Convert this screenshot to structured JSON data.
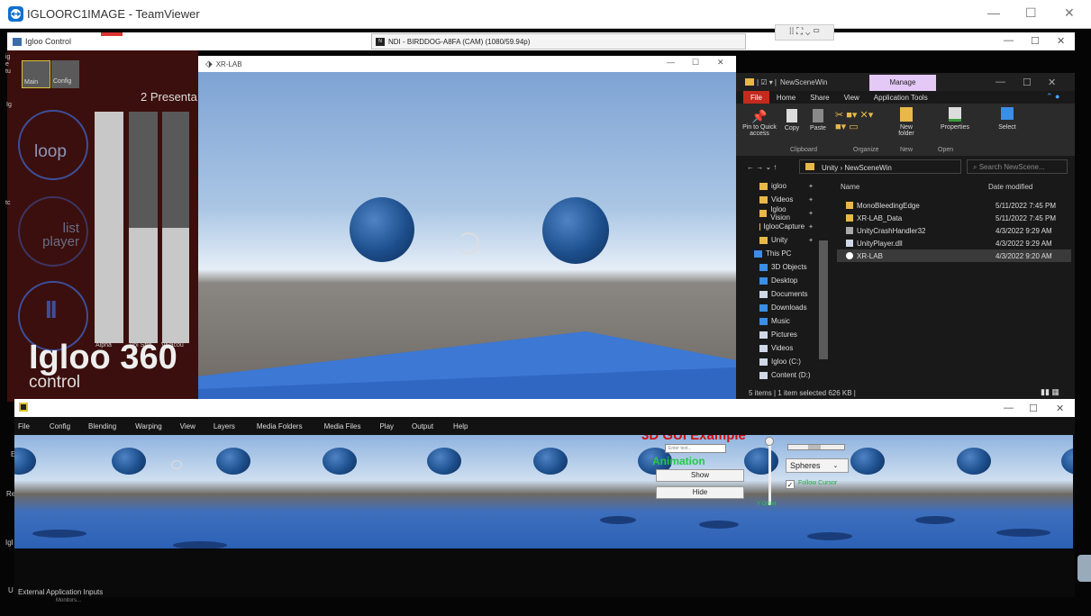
{
  "teamviewer": {
    "title": "IGLOORC1IMAGE - TeamViewer",
    "min": "—",
    "max": "☐",
    "close": "✕"
  },
  "igloo_control": {
    "window_title": "Igloo Control",
    "tabs": [
      "Main",
      "Config"
    ],
    "presentation_label": "2 Presenta",
    "loop_label": "loop",
    "list_player_label": "list player",
    "pause_symbol": "II",
    "slider_labels": [
      "Alpha",
      "Vol Stre",
      "Vivacou"
    ],
    "slider_levels": [
      1.0,
      0.5,
      0.5
    ],
    "logo_main": "Igloo 360",
    "logo_sub": "control",
    "side_text": [
      "ig",
      "e",
      "tu",
      "Ig",
      "tc",
      "E",
      "Re",
      "Igl",
      "U"
    ]
  },
  "ndi": {
    "title": "NDI - BIRDDOG-A8FA (CAM) (1080/59.94p)"
  },
  "xrlab": {
    "title": "XR-LAB",
    "min": "—",
    "max": "☐",
    "close": "✕"
  },
  "explorer": {
    "title": "NewSceneWin",
    "manage_tab": "Manage",
    "ribbon_tabs": [
      "File",
      "Home",
      "Share",
      "View",
      "Application Tools"
    ],
    "ribbon_groups": [
      "Clipboard",
      "Organize",
      "New",
      "Open"
    ],
    "ribbon_buttons": [
      "Pin to Quick access",
      "Copy",
      "Paste",
      "New folder",
      "Properties",
      "Select"
    ],
    "address": [
      "Unity",
      "NewSceneWin"
    ],
    "search_placeholder": "Search NewScene...",
    "col_name": "Name",
    "col_date": "Date modified",
    "nav_items": [
      {
        "label": "igloo",
        "kind": "folder"
      },
      {
        "label": "Videos",
        "kind": "folder"
      },
      {
        "label": "Igloo Vision",
        "kind": "folder"
      },
      {
        "label": "IglooCapture",
        "kind": "folder"
      },
      {
        "label": "Unity",
        "kind": "folder"
      },
      {
        "label": "This PC",
        "kind": "pc"
      },
      {
        "label": "3D Objects",
        "kind": "obj"
      },
      {
        "label": "Desktop",
        "kind": "desk"
      },
      {
        "label": "Documents",
        "kind": "doc"
      },
      {
        "label": "Downloads",
        "kind": "down"
      },
      {
        "label": "Music",
        "kind": "music"
      },
      {
        "label": "Pictures",
        "kind": "pic"
      },
      {
        "label": "Videos",
        "kind": "vid"
      },
      {
        "label": "Igloo (C:)",
        "kind": "drive"
      },
      {
        "label": "Content (D:)",
        "kind": "drive"
      }
    ],
    "files": [
      {
        "name": "MonoBleedingEdge",
        "date": "5/11/2022 7:45 PM",
        "kind": "folder"
      },
      {
        "name": "XR-LAB_Data",
        "date": "5/11/2022 7:45 PM",
        "kind": "folder"
      },
      {
        "name": "UnityCrashHandler32",
        "date": "4/3/2022 9:29 AM",
        "kind": "exe"
      },
      {
        "name": "UnityPlayer.dll",
        "date": "4/3/2022 9:29 AM",
        "kind": "dll"
      },
      {
        "name": "XR-LAB",
        "date": "4/3/2022 9:20 AM",
        "kind": "unity"
      }
    ],
    "status": "5 items  |  1 item selected  626 KB  |"
  },
  "igloo_main": {
    "menu": [
      "File",
      "Config",
      "Blending",
      "Warping",
      "View",
      "Layers",
      "Media Folders",
      "Media Files",
      "Play",
      "Output",
      "Help"
    ],
    "gui_title": "3D GUI Example",
    "gui_input_placeholder": "Enter text...",
    "animation_label": "Animation",
    "show_label": "Show",
    "hide_label": "Hide",
    "slider_label": "Y Offset",
    "dropdown_value": "Spheres",
    "follow_cursor_label": "Follow Cursor",
    "bottom_label": "External Application Inputs",
    "monitor_label": "Monitors..."
  },
  "colors": {
    "igloo_bg": "#3b0f0d",
    "gui_green": "#22cc44",
    "gui_red": "#cc1111",
    "manage_tab": "#e4c8f5"
  }
}
